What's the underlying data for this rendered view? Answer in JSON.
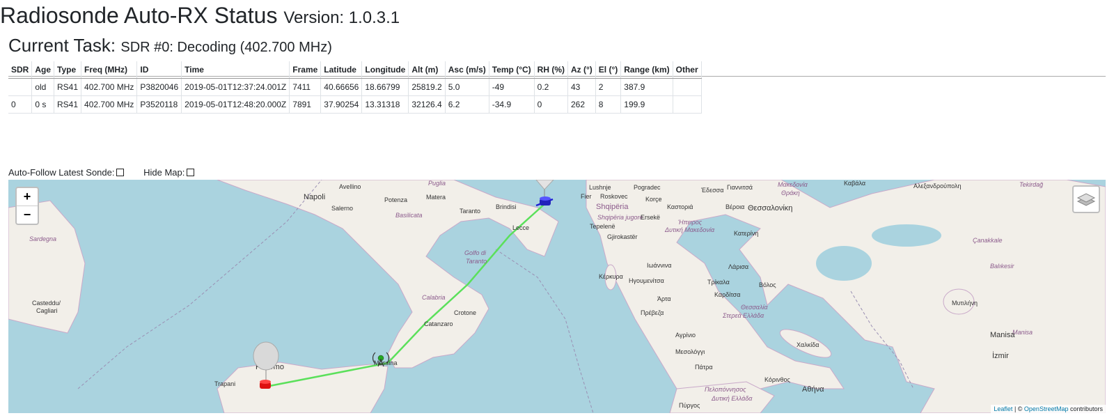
{
  "header": {
    "title": "Radiosonde Auto-RX Status",
    "version": "Version: 1.0.3.1"
  },
  "task": {
    "label": "Current Task:",
    "value": "SDR #0: Decoding (402.700 MHz)"
  },
  "table": {
    "columns": [
      "SDR",
      "Age",
      "Type",
      "Freq (MHz)",
      "ID",
      "Time",
      "Frame",
      "Latitude",
      "Longitude",
      "Alt (m)",
      "Asc (m/s)",
      "Temp (°C)",
      "RH (%)",
      "Az (°)",
      "El (°)",
      "Range (km)",
      "Other"
    ],
    "rows": [
      [
        "",
        "old",
        "RS41",
        "402.700 MHz",
        "P3820046",
        "2019-05-01T12:37:24.001Z",
        "7411",
        "40.66656",
        "18.66799",
        "25819.2",
        "5.0",
        "-49",
        "0.2",
        "43",
        "2",
        "387.9",
        ""
      ],
      [
        "0",
        "0 s",
        "RS41",
        "402.700 MHz",
        "P3520118",
        "2019-05-01T12:48:20.000Z",
        "7891",
        "37.90254",
        "13.31318",
        "32126.4",
        "6.2",
        "-34.9",
        "0",
        "262",
        "8",
        "199.9",
        ""
      ]
    ]
  },
  "options": {
    "auto_follow": "Auto-Follow Latest Sonde:",
    "hide_map": "Hide Map:"
  },
  "map": {
    "zoom_in": "+",
    "zoom_out": "−",
    "attribution_leaflet": "Leaflet",
    "attribution_sep": " | © ",
    "attribution_osm": "OpenStreetMap",
    "attribution_tail": " contributors",
    "labels": {
      "napoli": "Napoli",
      "avellino": "Avellino",
      "salerno": "Salerno",
      "potenza": "Potenza",
      "matera": "Matera",
      "taranto": "Taranto",
      "brindisi": "Brindisi",
      "lecce": "Lecce",
      "puglia": "Puglia",
      "basilicata": "Basilicata",
      "golfo": "Golfo di",
      "taranto2": "Taranto",
      "calabria": "Calabria",
      "crotone": "Crotone",
      "catanzaro": "Catanzaro",
      "messina": "Messina",
      "palermo": "Palermo",
      "trapani": "Trapani",
      "sardegna": "Sardegna",
      "cagliari1": "Casteddu/",
      "cagliari2": "Cagliari",
      "shqiperia": "Shqipëria",
      "fier": "Fier",
      "lushnje": "Lushnje",
      "pogradec": "Pogradec",
      "korce": "Korçe",
      "erseke": "Ersekë",
      "gjirokaster": "Gjirokastër",
      "tepelene": "Tepelenë",
      "roskovec": "Roskovec",
      "shqiperia_j": "Shqipëria jugore",
      "kastoria": "Καστοριά",
      "edessa": "Έδεσσα",
      "giannitsa": "Γιαννιτσά",
      "makedonia": "Μακεδονία",
      "thraki": "Θράκη",
      "veroia": "Βέροια",
      "thessaloniki": "Θεσσαλονίκη",
      "ipiros": "Ήπειρος",
      "dytiki_mak": "Δυτική Μακεδονία",
      "katerini": "Κατερίνη",
      "ioannina": "Ιωάννινα",
      "larisa": "Λάρισα",
      "trikala": "Τρίκαλα",
      "volos": "Βόλος",
      "kerkyra": "Κέρκυρα",
      "igoumenitsa": "Ηγουμενίτσα",
      "karditsa": "Καρδίτσα",
      "arta": "Άρτα",
      "thessalia": "Θεσσαλία",
      "sterea": "Στερεά Ελλάδα",
      "preveza": "Πρέβεζα",
      "agrinio": "Αγρίνιο",
      "mesolongi": "Μεσολόγγι",
      "patra": "Πάτρα",
      "chalkida": "Χαλκίδα",
      "athina": "Αθήνα",
      "korinthos": "Κόρινθος",
      "peloponnisos": "Πελοπόννησος",
      "dytiki_ell": "Δυτική Ελλάδα",
      "pyrgos": "Πύργος",
      "kavala": "Καβάλα",
      "alexandroupoli": "Αλεξανδρούπολη",
      "tekirdag": "Tekirdağ",
      "canakkale": "Çanakkale",
      "balikesir": "Balıkesir",
      "mytilini": "Μυτιλήνη",
      "manisa": "Manisa",
      "manisa2": "Manisa",
      "izmir": "İzmir"
    }
  }
}
